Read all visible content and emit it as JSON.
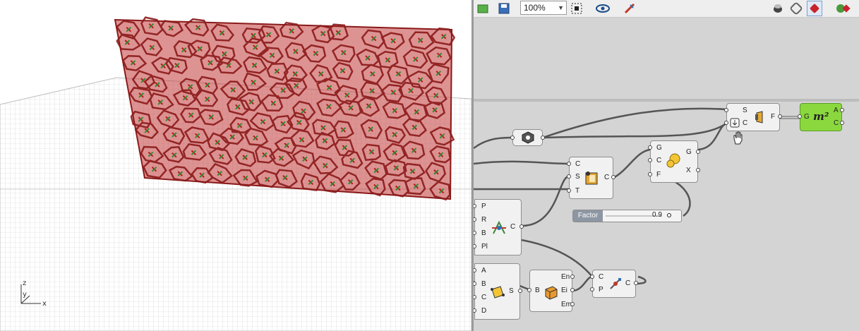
{
  "viewport": {
    "axis": {
      "z": "z",
      "y": "y",
      "x": "x"
    },
    "panel_color": "#c23b3b"
  },
  "toolbar": {
    "zoom": "100%",
    "icons": [
      "open-file-icon",
      "save-icon",
      "zoom-select",
      "frame-icon",
      "preview-eye-icon",
      "sketch-icon",
      "preview-mode-icon",
      "wireframe-icon",
      "shaded-icon",
      "bake-icon"
    ]
  },
  "components": {
    "offset_surface": {
      "inputs": [
        "S",
        "C"
      ],
      "output": "F"
    },
    "area": {
      "inputs": [
        "G"
      ],
      "outputs": [
        "A",
        "C"
      ],
      "label": "m²",
      "color": "#8ad83e"
    },
    "hex_param": {},
    "surface_closest": {
      "inputs": [
        "C",
        "S",
        "T"
      ],
      "output": "C"
    },
    "scale": {
      "inputs": [
        "G",
        "C",
        "F"
      ],
      "outputs": [
        "G",
        "X"
      ]
    },
    "factor_slider": {
      "label": "Factor",
      "value": "0.9"
    },
    "populate": {
      "inputs": [
        "P",
        "R",
        "B",
        "Pl"
      ],
      "output": "C"
    },
    "plane_srf": {
      "inputs": [
        "A",
        "B",
        "C",
        "D"
      ],
      "output": "S"
    },
    "brep_edges": {
      "inputs": [
        "B"
      ],
      "outputs": [
        "En",
        "Ei",
        "Em"
      ]
    },
    "curve_pt": {
      "inputs": [
        "C",
        "P"
      ],
      "output": "C"
    }
  }
}
